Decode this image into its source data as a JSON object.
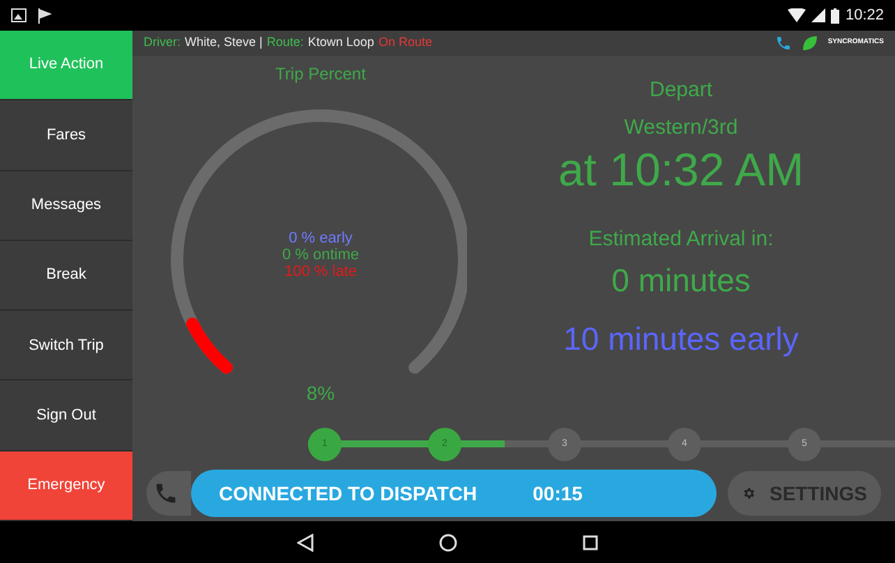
{
  "status_bar": {
    "time": "10:22"
  },
  "sidebar": {
    "items": [
      {
        "label": "Live Action",
        "selected": true,
        "kind": "nav"
      },
      {
        "label": "Fares",
        "selected": false,
        "kind": "nav"
      },
      {
        "label": "Messages",
        "selected": false,
        "kind": "nav"
      },
      {
        "label": "Break",
        "selected": false,
        "kind": "nav"
      },
      {
        "label": "Switch Trip",
        "selected": false,
        "kind": "nav"
      },
      {
        "label": "Sign Out",
        "selected": false,
        "kind": "nav"
      },
      {
        "label": "Emergency",
        "selected": false,
        "kind": "emergency"
      }
    ]
  },
  "info_bar": {
    "segments": [
      {
        "text": "Driver:",
        "kind": "label"
      },
      {
        "text": "White, Steve |",
        "kind": "value"
      },
      {
        "text": "Route:",
        "kind": "label"
      },
      {
        "text": "Ktown Loop",
        "kind": "value"
      },
      {
        "text": "On Route",
        "kind": "status"
      }
    ],
    "logo": "SYNCROMATICS"
  },
  "gauge": {
    "title": "Trip Percent",
    "lines": [
      {
        "text": "0 % early",
        "kind": "early"
      },
      {
        "text": "0 % ontime",
        "kind": "ontime"
      },
      {
        "text": "100 % late",
        "kind": "late"
      }
    ],
    "reading": "8%"
  },
  "departure": {
    "label": "Depart",
    "stop": "Western/3rd",
    "time": "at 10:32 AM",
    "arrival_label": "Estimated Arrival in:",
    "arrival": "0 minutes",
    "status": "10 minutes early"
  },
  "stops": [
    {
      "label": "1",
      "selected": true
    },
    {
      "label": "2",
      "selected": true
    },
    {
      "label": "3",
      "selected": false
    },
    {
      "label": "4",
      "selected": false
    },
    {
      "label": "5",
      "selected": false
    }
  ],
  "dispatch": {
    "label": "CONNECTED TO DISPATCH",
    "timer": "00:15"
  },
  "settings_button": "SETTINGS"
}
